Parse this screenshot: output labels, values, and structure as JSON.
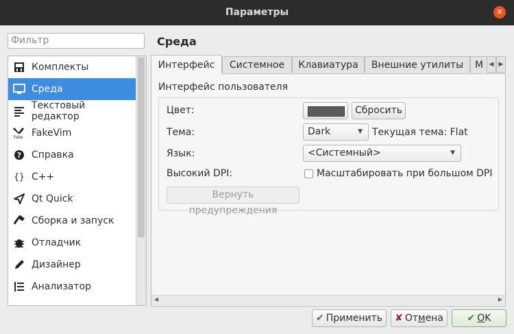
{
  "window": {
    "title": "Параметры"
  },
  "filter": {
    "placeholder": "Фильтр"
  },
  "sidebar": {
    "items": [
      {
        "label": "Комплекты",
        "icon": "kits-icon"
      },
      {
        "label": "Среда",
        "icon": "monitor-icon",
        "selected": true
      },
      {
        "label": "Текстовый редактор",
        "icon": "text-editor-icon"
      },
      {
        "label": "FakeVim",
        "icon": "fakevim-icon"
      },
      {
        "label": "Справка",
        "icon": "help-icon"
      },
      {
        "label": "C++",
        "icon": "braces-icon"
      },
      {
        "label": "Qt Quick",
        "icon": "qt-quick-icon"
      },
      {
        "label": "Сборка и запуск",
        "icon": "hammer-icon"
      },
      {
        "label": "Отладчик",
        "icon": "bug-icon"
      },
      {
        "label": "Дизайнер",
        "icon": "pen-icon"
      },
      {
        "label": "Анализатор",
        "icon": "analyzer-icon"
      }
    ]
  },
  "page": {
    "title": "Среда"
  },
  "tabs": [
    "Интерфейс",
    "Системное",
    "Клавиатура",
    "Внешние утилиты",
    "М"
  ],
  "interface": {
    "group_title": "Интерфейс пользователя",
    "color_label": "Цвет:",
    "reset_label": "Сбросить",
    "theme_label": "Тема:",
    "theme_value": "Dark",
    "current_theme": "Текущая тема: Flat",
    "language_label": "Язык:",
    "language_value": "<Системный>",
    "high_dpi_label": "Высокий DPI:",
    "high_dpi_checkbox": "Масштабировать при большом DPI",
    "high_dpi_checked": false,
    "restore_warnings": "Вернуть предупреждения"
  },
  "buttons": {
    "apply": "Применить",
    "cancel_prefix": "От",
    "cancel_underlined": "м",
    "cancel_suffix": "ена",
    "ok_underlined": "O",
    "ok_suffix": "K"
  },
  "colors": {
    "accent": "#3d8ee0",
    "close": "#e95420",
    "titlebar": "#2c2c2c"
  }
}
